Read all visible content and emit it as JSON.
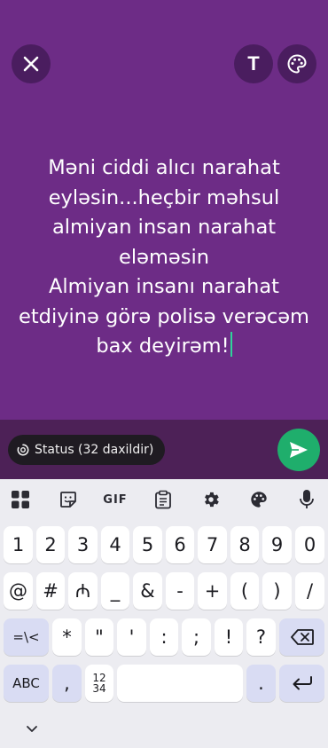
{
  "composer": {
    "background_color": "#6d2c86",
    "status_text": "Məni ciddi alıcı narahat\neyləsin...heçbir məhsul\nalmiyan insan narahat\neləməsin\nAlmiyan insanı narahat\netdiyinə görə polisə verəcəm\nbax deyirəm!",
    "text_tool_label": "T"
  },
  "bottombar": {
    "audience_label": "Status (32 daxildir)",
    "send_color": "#1fae6c"
  },
  "keyboard": {
    "toolbar": {
      "gif_label": "GIF"
    },
    "rows": [
      [
        "1",
        "2",
        "3",
        "4",
        "5",
        "6",
        "7",
        "8",
        "9",
        "0"
      ],
      [
        "@",
        "#",
        "₼",
        "_",
        "&",
        "-",
        "+",
        "(",
        ")",
        "/"
      ],
      [
        "=\\<",
        "*",
        "\"",
        "'",
        ":",
        ";",
        "!",
        "?"
      ],
      [
        "ABC",
        ",",
        "12\n34",
        ".",
        ""
      ]
    ],
    "keys": {
      "symbols2_label": "=\\<",
      "abc_label": "ABC",
      "comma_label": ",",
      "numpad_label_top": "12",
      "numpad_label_bottom": "34",
      "period_label": "."
    }
  }
}
